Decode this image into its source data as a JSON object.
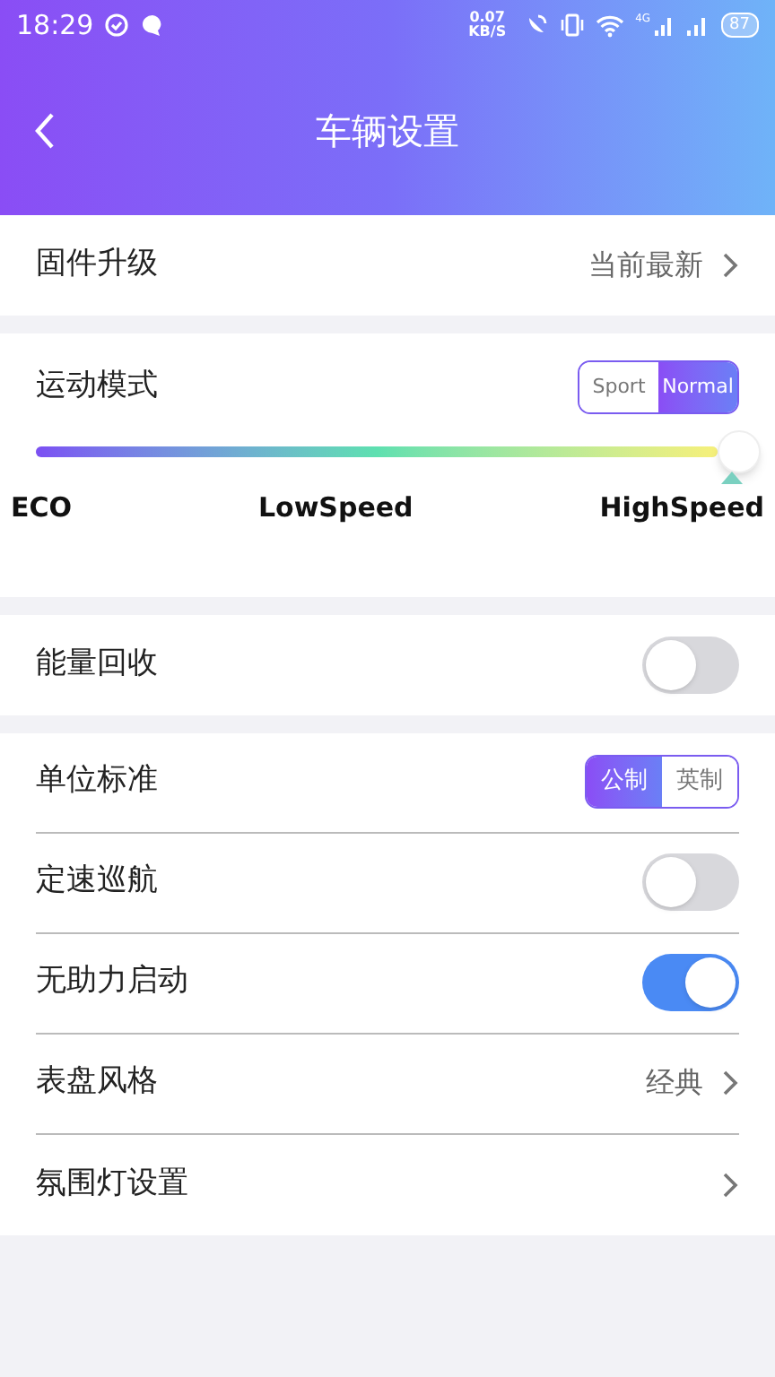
{
  "status_bar": {
    "time": "18:29",
    "net_speed": [
      "0.07",
      "KB/S"
    ],
    "network": "4G",
    "battery": "87"
  },
  "header": {
    "title": "车辆设置"
  },
  "sections": [
    {
      "rows": [
        {
          "kind": "link",
          "label": "固件升级",
          "value": "当前最新"
        }
      ]
    },
    {
      "rows": [
        {
          "kind": "mode",
          "label": "运动模式",
          "options": [
            {
              "label": "Sport",
              "selected": false
            },
            {
              "label": "Normal",
              "selected": true
            }
          ],
          "level": 1,
          "marks": [
            "ECO",
            "LowSpeed",
            "HighSpeed"
          ]
        }
      ]
    },
    {
      "rows": [
        {
          "kind": "toggle",
          "label": "能量回收",
          "on": false
        }
      ]
    },
    {
      "rows": [
        {
          "kind": "segmented",
          "label": "单位标准",
          "options": [
            {
              "label": "公制",
              "selected": true
            },
            {
              "label": "英制",
              "selected": false
            }
          ]
        },
        {
          "kind": "toggle",
          "label": "定速巡航",
          "on": false
        },
        {
          "kind": "toggle",
          "label": "无助力启动",
          "on": true
        },
        {
          "kind": "link",
          "label": "表盘风格",
          "value": "经典"
        },
        {
          "kind": "link",
          "label": "氛围灯设置"
        }
      ]
    }
  ]
}
